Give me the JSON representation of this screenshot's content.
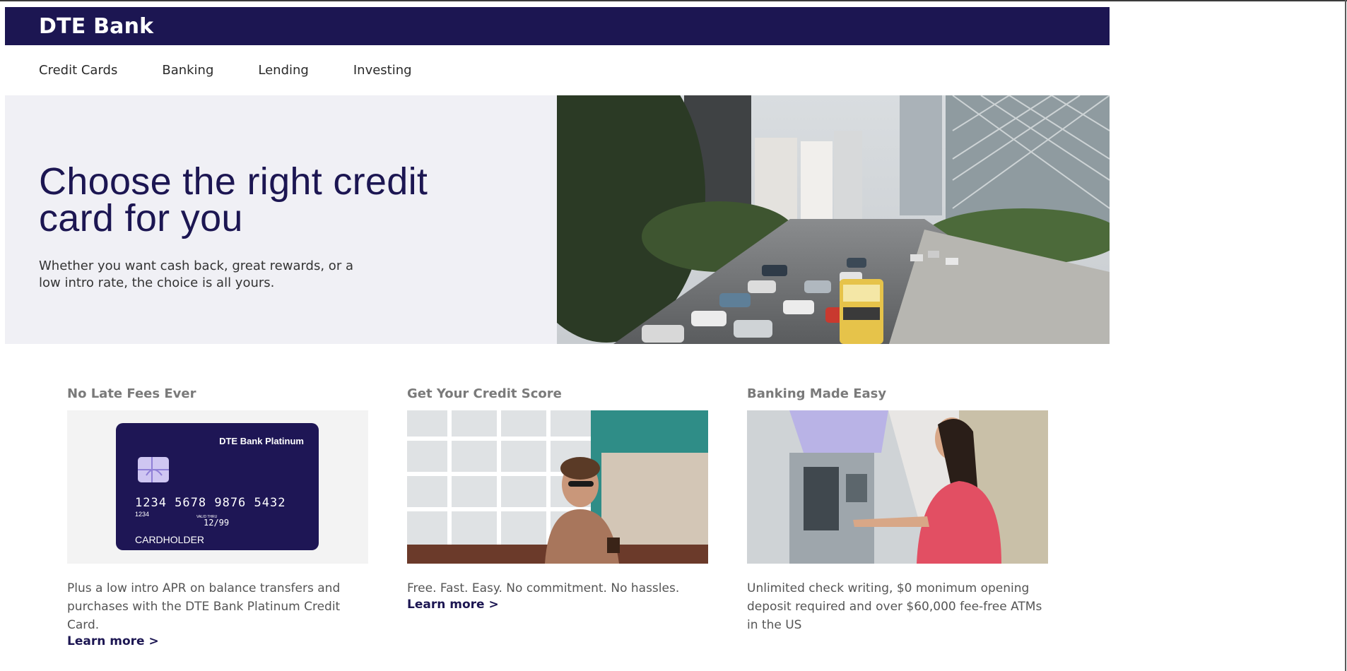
{
  "header": {
    "brand": "DTE Bank"
  },
  "nav": {
    "items": [
      {
        "label": "Credit Cards"
      },
      {
        "label": "Banking"
      },
      {
        "label": "Lending"
      },
      {
        "label": "Investing"
      }
    ]
  },
  "hero": {
    "title": "Choose the right credit card for you",
    "subtitle": "Whether you want cash back, great rewards, or a low intro rate, the choice is all yours.",
    "image_alt_icon": "city-traffic-photo"
  },
  "features": [
    {
      "title": "No Late Fees Ever",
      "description": "Plus a low intro APR on balance transfers and purchases with the DTE Bank Platinum Credit Card.",
      "link": "Learn more >",
      "card": {
        "name": "DTE Bank Platinum",
        "number": "1234  5678  9876  5432",
        "small_number": "1234",
        "valid_label": "VALID THRU",
        "expiry": "12/99",
        "holder": "CARDHOLDER"
      }
    },
    {
      "title": "Get Your Credit Score",
      "description": "Free. Fast. Easy. No commitment. No hassles.",
      "link": "Learn more >"
    },
    {
      "title": "Banking Made Easy",
      "description": "Unlimited check writing, $0 monimum opening deposit required and over $60,000 fee-free ATMs in the US"
    }
  ],
  "colors": {
    "brand": "#1c1652",
    "hero_bg": "#f0f0f5"
  }
}
